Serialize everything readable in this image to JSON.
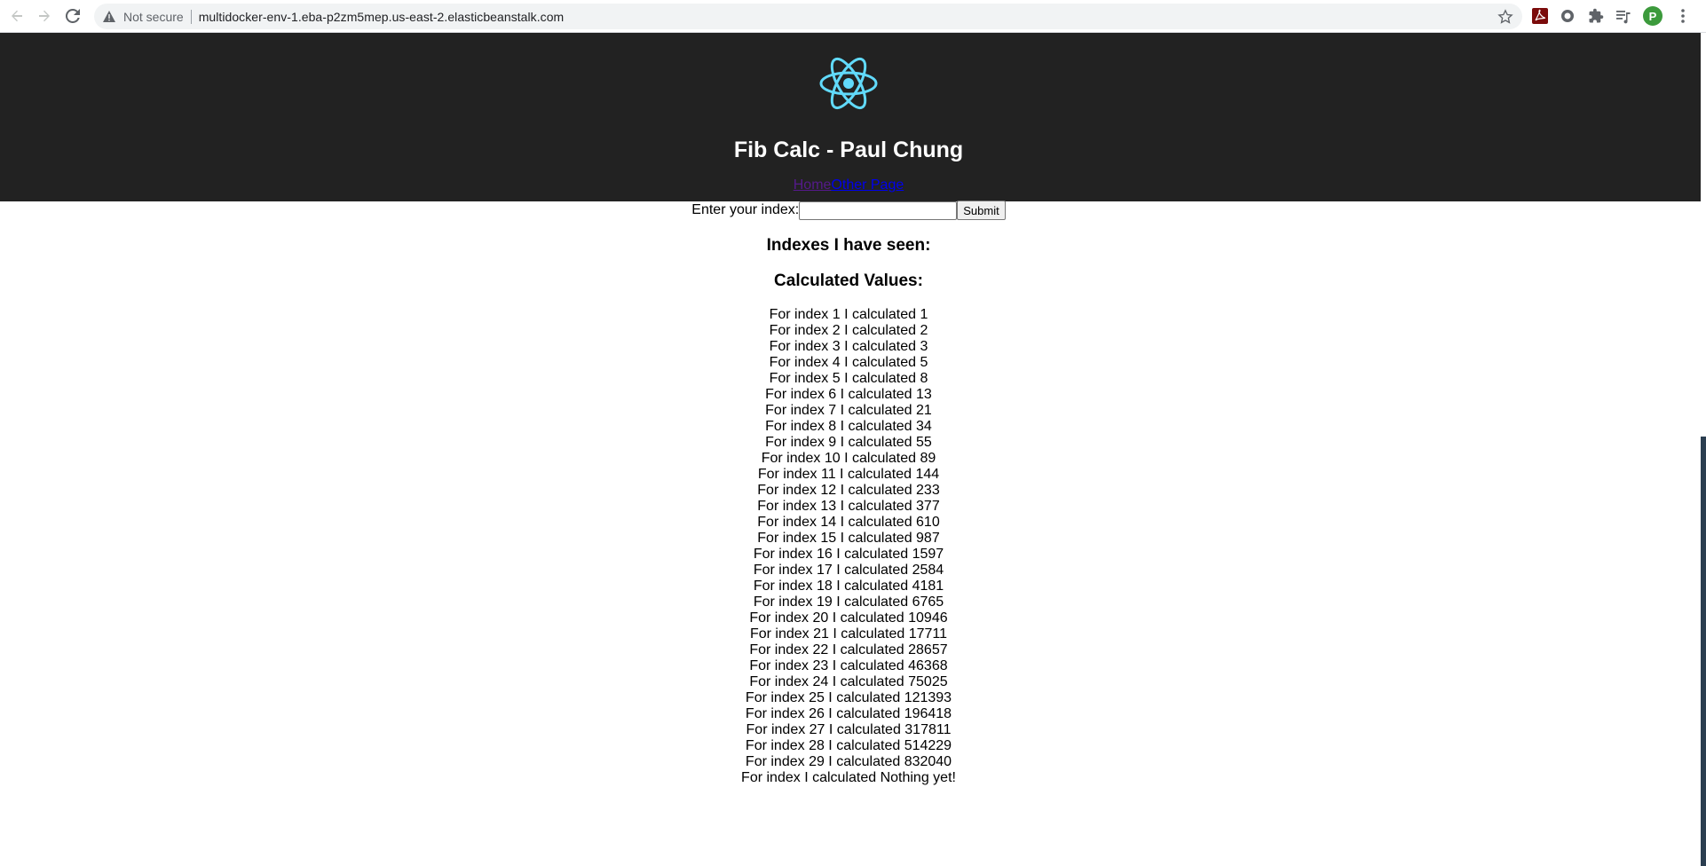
{
  "browser": {
    "security_label": "Not secure",
    "url": "multidocker-env-1.eba-p2zm5mep.us-east-2.elasticbeanstalk.com",
    "profile_initial": "P"
  },
  "header": {
    "title": "Fib Calc - Paul Chung",
    "links": [
      "Home",
      "Other Page"
    ]
  },
  "form": {
    "label": "Enter your index:",
    "input_value": "",
    "submit_label": "Submit"
  },
  "sections": {
    "seen_heading": "Indexes I have seen:",
    "calculated_heading": "Calculated Values:"
  },
  "values": [
    "For index 1 I calculated 1",
    "For index 2 I calculated 2",
    "For index 3 I calculated 3",
    "For index 4 I calculated 5",
    "For index 5 I calculated 8",
    "For index 6 I calculated 13",
    "For index 7 I calculated 21",
    "For index 8 I calculated 34",
    "For index 9 I calculated 55",
    "For index 10 I calculated 89",
    "For index 11 I calculated 144",
    "For index 12 I calculated 233",
    "For index 13 I calculated 377",
    "For index 14 I calculated 610",
    "For index 15 I calculated 987",
    "For index 16 I calculated 1597",
    "For index 17 I calculated 2584",
    "For index 18 I calculated 4181",
    "For index 19 I calculated 6765",
    "For index 20 I calculated 10946",
    "For index 21 I calculated 17711",
    "For index 22 I calculated 28657",
    "For index 23 I calculated 46368",
    "For index 24 I calculated 75025",
    "For index 25 I calculated 121393",
    "For index 26 I calculated 196418",
    "For index 27 I calculated 317811",
    "For index 28 I calculated 514229",
    "For index 29 I calculated 832040",
    "For index I calculated Nothing yet!"
  ],
  "colors": {
    "header_bg": "#222222",
    "logo": "#61dafb",
    "visited_link": "#551a8b",
    "link": "#0000ee"
  }
}
